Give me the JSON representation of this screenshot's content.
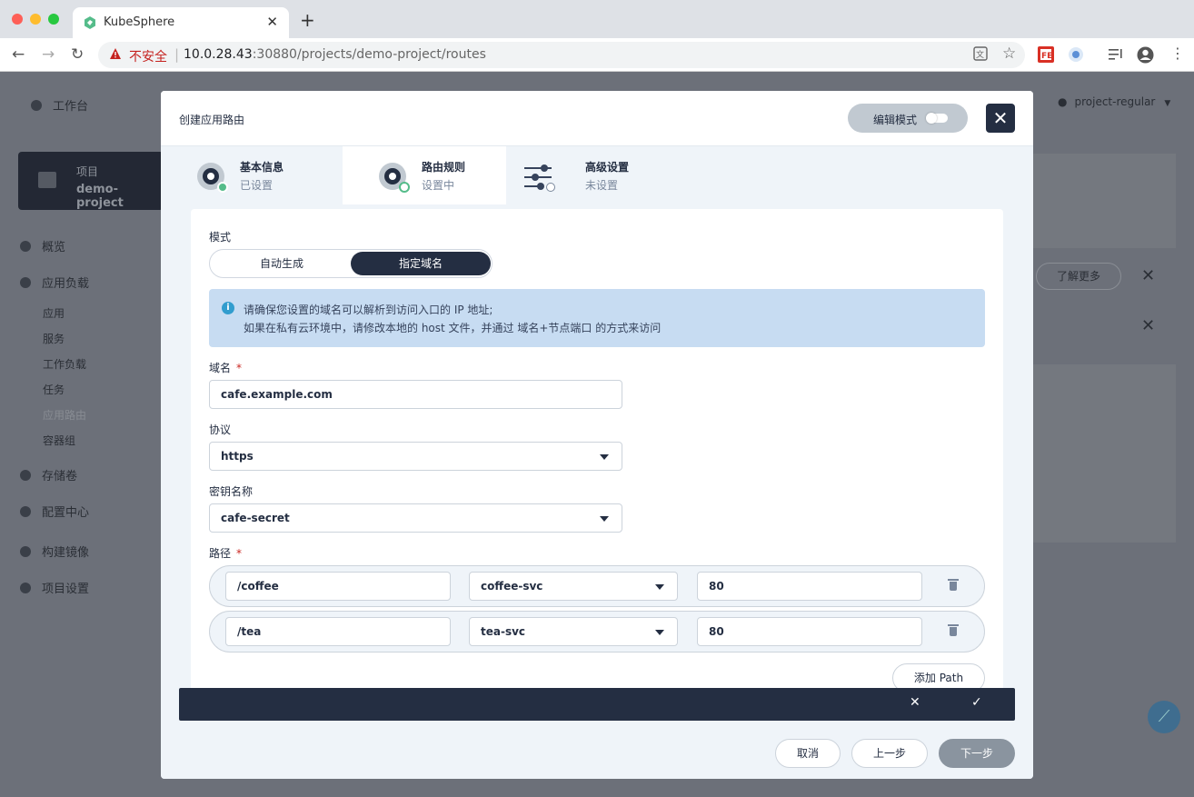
{
  "browser": {
    "tab_title": "KubeSphere",
    "insecure_label": "不安全",
    "url_host": "10.0.28.43",
    "url_path": ":30880/projects/demo-project/routes"
  },
  "app": {
    "workbench": "工作台",
    "project_label": "项目",
    "project_name": "demo-project",
    "user": "project-regular",
    "learn_more": "了解更多",
    "nav": {
      "overview": "概览",
      "app_workloads": "应用负载",
      "sub": [
        "应用",
        "服务",
        "工作负载",
        "任务",
        "应用路由",
        "容器组"
      ],
      "storage": "存储卷",
      "config": "配置中心",
      "image_builder": "构建镜像",
      "project_settings": "项目设置"
    }
  },
  "modal": {
    "title": "创建应用路由",
    "edit_mode": "编辑模式",
    "steps": [
      {
        "name": "基本信息",
        "status": "已设置"
      },
      {
        "name": "路由规则",
        "status": "设置中"
      },
      {
        "name": "高级设置",
        "status": "未设置"
      }
    ],
    "mode_label": "模式",
    "mode_options": [
      "自动生成",
      "指定域名"
    ],
    "mode_selected": "指定域名",
    "info_lines": [
      "请确保您设置的域名可以解析到访问入口的 IP 地址;",
      "如果在私有云环境中，请修改本地的 host 文件，并通过 域名+节点端口 的方式来访问"
    ],
    "domain_label": "域名",
    "domain_value": "cafe.example.com",
    "protocol_label": "协议",
    "protocol_value": "https",
    "secret_label": "密钥名称",
    "secret_value": "cafe-secret",
    "path_label": "路径",
    "paths": [
      {
        "path": "/coffee",
        "service": "coffee-svc",
        "port": "80"
      },
      {
        "path": "/tea",
        "service": "tea-svc",
        "port": "80"
      }
    ],
    "add_path": "添加 Path",
    "footer": {
      "cancel": "取消",
      "prev": "上一步",
      "next": "下一步"
    }
  }
}
